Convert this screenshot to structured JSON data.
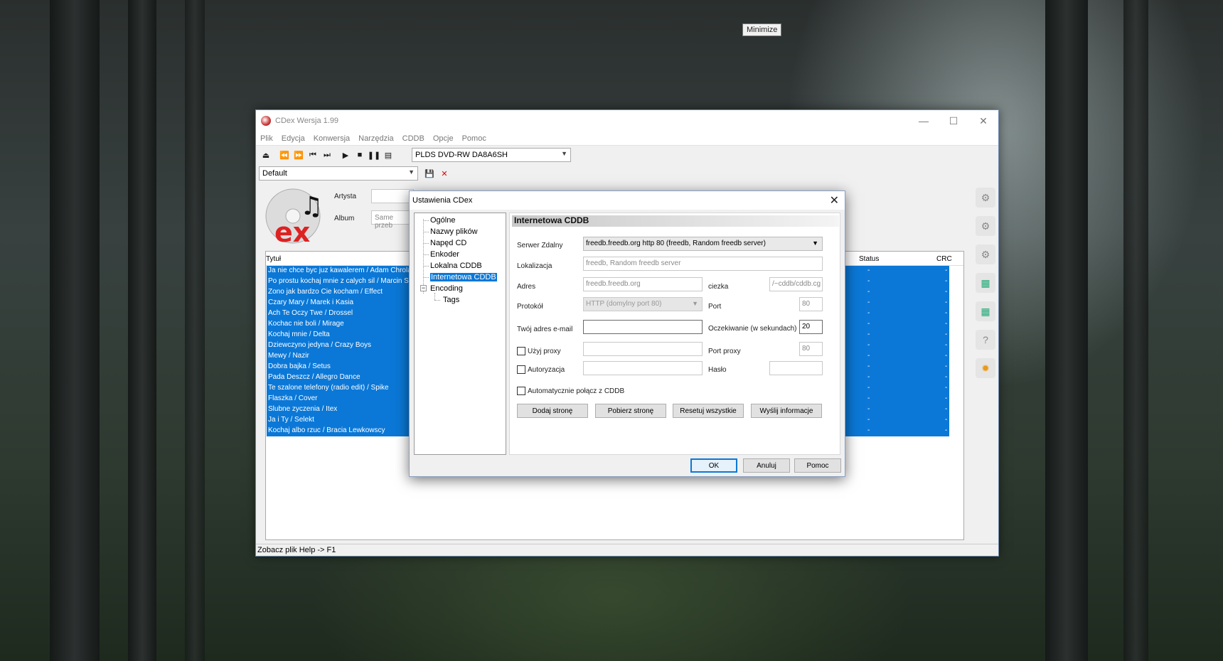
{
  "tooltip": "Minimize",
  "main_window": {
    "title": "CDex Wersja 1.99",
    "menu": [
      "Plik",
      "Edycja",
      "Konwersja",
      "Narzędzia",
      "CDDB",
      "Opcje",
      "Pomoc"
    ],
    "drive_select": "PLDS    DVD-RW DA8A6SH",
    "profile_select": "Default",
    "artist_label": "Artysta",
    "album_label": "Album",
    "album_value": "Same przeb",
    "columns": {
      "title": "Tytuł",
      "status": "Status",
      "crc": "CRC"
    },
    "tracks": [
      {
        "title": "Ja  nie chce byc juz kawalerem / Adam Chrola",
        "status": "-",
        "crc": "-"
      },
      {
        "title": "Po prostu kochaj mnie z calych sil / Marcin Siegi",
        "status": "-",
        "crc": "-"
      },
      {
        "title": "Zono jak bardzo Cie kocham / Effect",
        "status": "-",
        "crc": "-"
      },
      {
        "title": "Czary Mary / Marek i Kasia",
        "status": "-",
        "crc": "-"
      },
      {
        "title": "Ach Te Oczy Twe / Drossel",
        "status": "-",
        "crc": "-"
      },
      {
        "title": "Kochac nie boli / Mirage",
        "status": "-",
        "crc": "-"
      },
      {
        "title": "Kochaj mnie / Delta",
        "status": "-",
        "crc": "-"
      },
      {
        "title": "Dziewczyno jedyna / Crazy Boys",
        "status": "-",
        "crc": "-"
      },
      {
        "title": "Mewy / Nazir",
        "status": "-",
        "crc": "-"
      },
      {
        "title": "Dobra bajka / Setus",
        "status": "-",
        "crc": "-"
      },
      {
        "title": "Pada Deszcz / Allegro Dance",
        "status": "-",
        "crc": "-"
      },
      {
        "title": "Te szalone telefony (radio edit) / Spike",
        "status": "-",
        "crc": "-"
      },
      {
        "title": "Flaszka / Cover",
        "status": "-",
        "crc": "-"
      },
      {
        "title": "Slubne zyczenia / Itex",
        "status": "-",
        "crc": "-"
      },
      {
        "title": "Ja i Ty / Selekt",
        "status": "-",
        "crc": "-"
      },
      {
        "title": "Kochaj albo rzuc / Bracia Lewkowscy",
        "status": "-",
        "crc": "-"
      }
    ],
    "status_bar": "Zobacz plik Help -> F1"
  },
  "dialog": {
    "title": "Ustawienia CDex",
    "tree": [
      {
        "label": "Ogólne"
      },
      {
        "label": "Nazwy plików"
      },
      {
        "label": "Napęd CD"
      },
      {
        "label": "Enkoder"
      },
      {
        "label": "Lokalna CDDB"
      },
      {
        "label": "Internetowa CDDB",
        "selected": true
      },
      {
        "label": "Encoding",
        "expanded": true
      },
      {
        "label": "Tags"
      }
    ],
    "section_title": "Internetowa CDDB",
    "fields": {
      "server_label": "Serwer Zdalny",
      "server_value": "freedb.freedb.org http  80  (freedb, Random freedb server)",
      "location_label": "Lokalizacja",
      "location_value": "freedb, Random freedb server",
      "address_label": "Adres",
      "address_value": "freedb.freedb.org",
      "path_label": "ciezka",
      "path_value": "/~cddb/cddb.cg",
      "protocol_label": "Protokół",
      "protocol_value": "HTTP (domylny port 80)",
      "port_label": "Port",
      "port_value": "80",
      "email_label": "Twój adres e-mail",
      "email_value": "",
      "timeout_label": "Oczekiwanie (w sekundach)",
      "timeout_value": "20",
      "proxy_label": "Użyj proxy",
      "proxy_value": "",
      "proxy_port_label": "Port proxy",
      "proxy_port_value": "80",
      "auth_label": "Autoryzacja",
      "auth_value": "",
      "password_label": "Hasło",
      "password_value": "",
      "auto_connect_label": "Automatycznie połącz z CDDB"
    },
    "buttons": {
      "add_page": "Dodaj stronę",
      "get_page": "Pobierz stronę",
      "reset_all": "Resetuj wszystkie",
      "send_info": "Wyślij informacje",
      "ok": "OK",
      "cancel": "Anuluj",
      "help": "Pomoc"
    }
  }
}
